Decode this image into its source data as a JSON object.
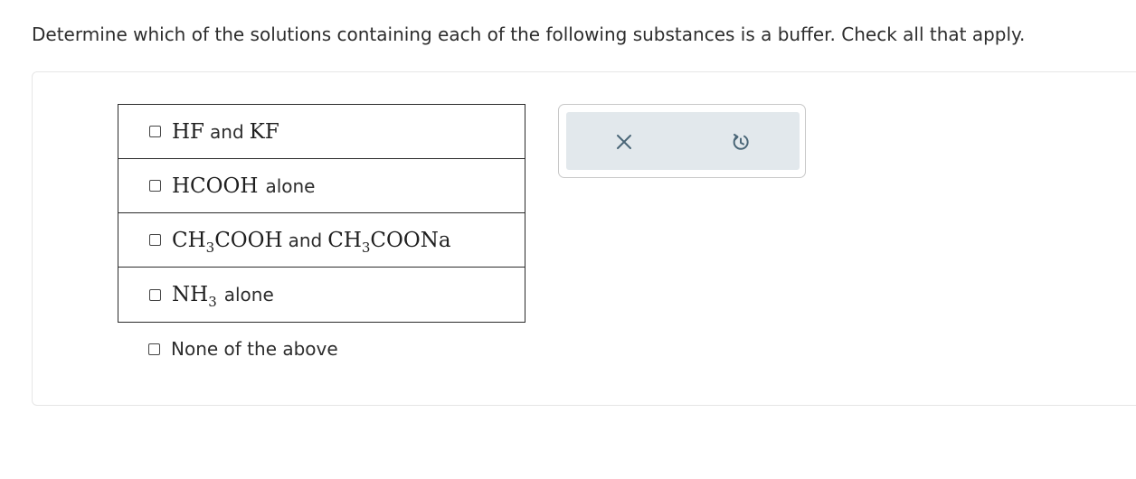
{
  "question": {
    "text": "Determine which of the solutions containing each of the following substances is a buffer. Check all that apply."
  },
  "options": [
    {
      "parts": [
        "HF",
        "and",
        "KF"
      ]
    },
    {
      "parts": [
        "HCOOH",
        "alone"
      ]
    },
    {
      "a_main": "CH",
      "a_sub": "3",
      "a_rest": "COOH",
      "conj": "and",
      "b_main": "CH",
      "b_sub": "3",
      "b_rest": "COONa"
    },
    {
      "main": "NH",
      "sub": "3",
      "suffix": "alone"
    }
  ],
  "none_option": {
    "label": "None of the above"
  },
  "tools": {
    "clear_icon": "close-icon",
    "reset_icon": "undo-icon",
    "icon_color": "#4a6677"
  },
  "colors": {
    "panel_border": "#e6e6e6",
    "tool_background": "#e2e8ec",
    "table_border": "#2b2b2b"
  }
}
